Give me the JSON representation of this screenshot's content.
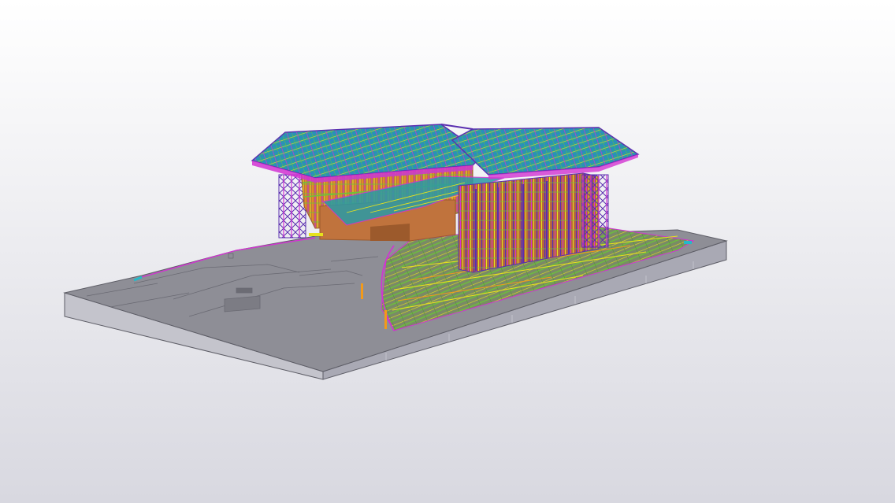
{
  "colors": {
    "background_top": "#ffffff",
    "background_bottom": "#d8d8e0",
    "slab_top": "#8e8e96",
    "slab_side": "#a9a9b4",
    "slab_front": "#c4c4cc",
    "slab_edge": "#5d5d66",
    "concrete_core": "#c0733d",
    "concrete_core_dark": "#9c5a2c",
    "steel_magenta": "#d233d2",
    "steel_purple": "#5a2fb0",
    "steel_blue": "#2a7fd8",
    "steel_cyan": "#25b9c8",
    "steel_yellow": "#e6e21c",
    "steel_green": "#6cc23a",
    "steel_orange": "#f29a1a",
    "roof_teal": "#2a9aa6"
  },
  "model": {
    "description_icon": "bim-3d-model-icon",
    "view_mode": "perspective"
  }
}
